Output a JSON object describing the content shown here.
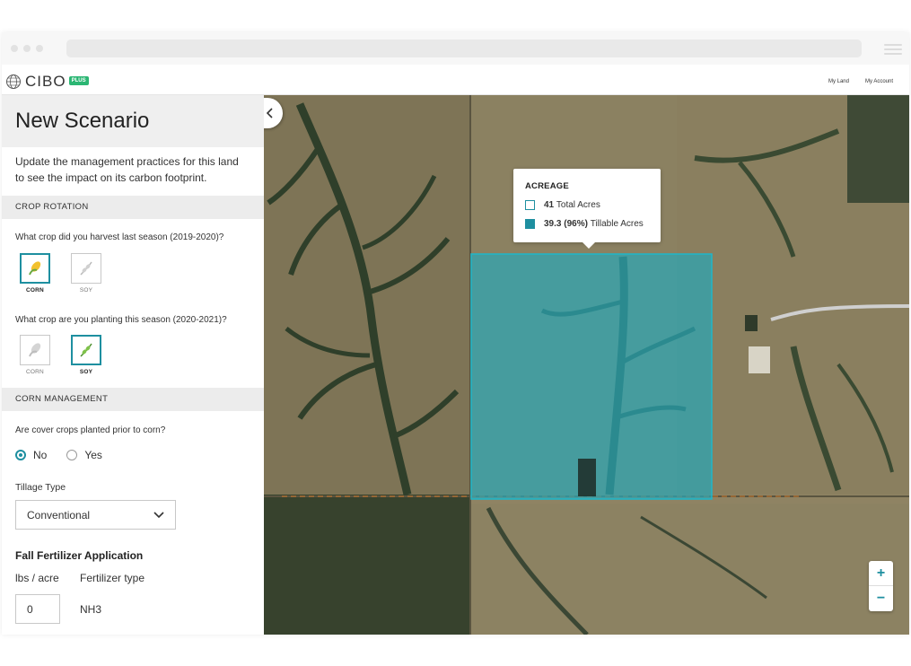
{
  "app": {
    "brand": "CIBO",
    "brand_badge": "PLUS",
    "nav": [
      "My Land",
      "My Account"
    ]
  },
  "sidebar": {
    "title": "New Scenario",
    "intro": "Update the management practices for this land to see the impact on its carbon footprint.",
    "crop_rotation": {
      "heading": "CROP ROTATION",
      "last_season_question": "What crop did you harvest last season (2019-2020)?",
      "this_season_question": "What crop are you planting this season (2020-2021)?",
      "last_season_options": [
        {
          "label": "CORN",
          "icon": "corn-icon",
          "selected": true
        },
        {
          "label": "SOY",
          "icon": "soy-icon",
          "selected": false
        }
      ],
      "this_season_options": [
        {
          "label": "CORN",
          "icon": "corn-icon",
          "selected": false
        },
        {
          "label": "SOY",
          "icon": "soy-icon",
          "selected": true
        }
      ]
    },
    "corn_management": {
      "heading": "CORN MANAGEMENT",
      "cover_crop_question": "Are cover crops planted prior to corn?",
      "cover_crop_options": [
        {
          "label": "No",
          "selected": true
        },
        {
          "label": "Yes",
          "selected": false
        }
      ],
      "tillage_label": "Tillage Type",
      "tillage_value": "Conventional",
      "fertilizer_heading": "Fall Fertilizer Application",
      "lbs_label": "lbs / acre",
      "lbs_value": "0",
      "fertilizer_type_label": "Fertilizer type",
      "fertilizer_type_value": "NH3"
    }
  },
  "map": {
    "tooltip": {
      "title": "ACREAGE",
      "total_value": "41",
      "total_label": "Total Acres",
      "tillable_value": "39.3 (96%)",
      "tillable_label": "Tillable Acres"
    },
    "zoom_in": "+",
    "zoom_out": "−",
    "colors": {
      "field_overlay": "#2aa6b6",
      "accent": "#1e8fa0",
      "brand_green": "#2bb673"
    }
  }
}
